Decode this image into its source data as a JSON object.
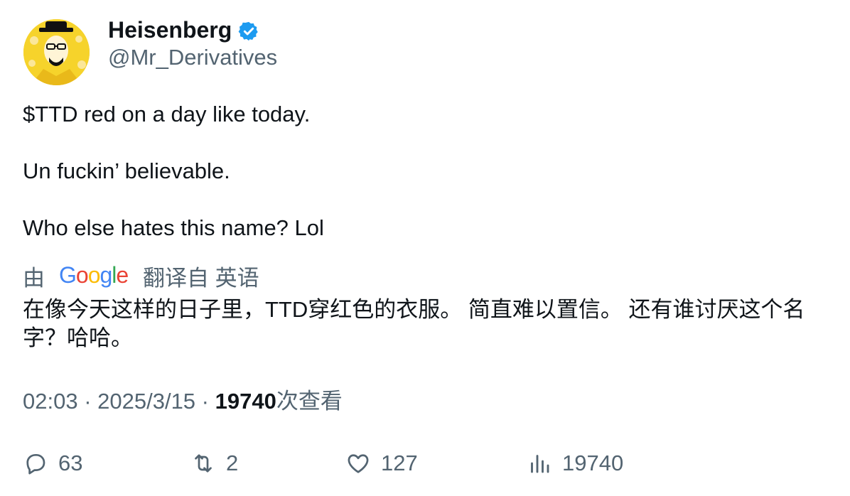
{
  "author": {
    "display_name": "Heisenberg",
    "handle": "@Mr_Derivatives",
    "verified": true,
    "verified_color": "#1d9bf0"
  },
  "tweet": {
    "lines": [
      "$TTD red on a day like today.",
      "Un fuckin’ believable.",
      "Who else hates this name? Lol"
    ]
  },
  "translation": {
    "prefix": "由",
    "provider_logo": "Google",
    "suffix": "翻译自 英语",
    "text": "在像今天这样的日子里，TTD穿红色的衣服。 简直难以置信。 还有谁讨厌这个名字？哈哈。"
  },
  "meta": {
    "time": "02:03",
    "separator": " · ",
    "date": "2025/3/15",
    "views_count": "19740",
    "views_label": "次查看"
  },
  "actions": {
    "replies": "63",
    "retweets": "2",
    "likes": "127",
    "views": "19740"
  },
  "icons": {
    "reply": "reply-icon",
    "retweet": "retweet-icon",
    "like": "heart-icon",
    "views": "analytics-icon",
    "verified": "verified-badge-icon"
  },
  "colors": {
    "text": "#0f1419",
    "secondary": "#536471",
    "avatar_bg": "#f6d32b"
  }
}
